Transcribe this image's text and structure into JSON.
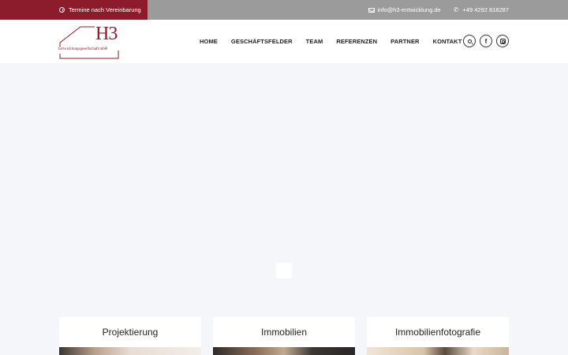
{
  "topbar": {
    "appointment": "Termine nach Vereinbarung",
    "email": "info@h3-entwicklung.de",
    "phone": "+49 4292 818287"
  },
  "logo": {
    "mark": "H3",
    "subtitle": "Entwicklungsgesellschaft mbH"
  },
  "nav": {
    "items": [
      "HOME",
      "GESCHÄFTSFELDER",
      "TEAM",
      "REFERENZEN",
      "PARTNER",
      "KONTAKT"
    ]
  },
  "social": {
    "icons": [
      "search-icon",
      "facebook-icon",
      "instagram-icon"
    ]
  },
  "cards": [
    {
      "title": "Projektierung"
    },
    {
      "title": "Immobilien"
    },
    {
      "title": "Immobilienfotografie"
    }
  ],
  "colors": {
    "brand": "#8c1c2b",
    "topbar": "#9b9b9b",
    "background": "#f4f6f9"
  }
}
